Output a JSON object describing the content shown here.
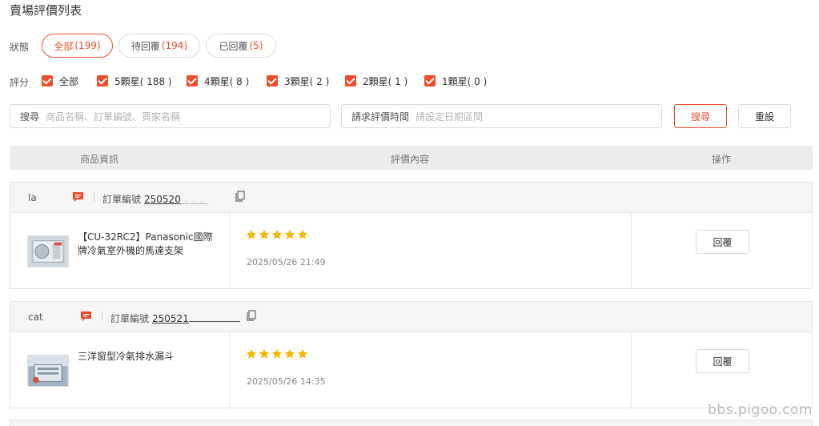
{
  "page_title": "賣場評價列表",
  "filters": {
    "status_label": "狀態",
    "status_pills": [
      {
        "label": "全部",
        "count": "(199)",
        "active": true
      },
      {
        "label": "待回覆",
        "count": "(194)",
        "active": false
      },
      {
        "label": "已回覆",
        "count": "(5)",
        "active": false
      }
    ],
    "rating_label": "評分",
    "rating_options": [
      {
        "label": "全部",
        "checked": true
      },
      {
        "label": "5顆星( 188 )",
        "checked": true
      },
      {
        "label": "4顆星( 8 )",
        "checked": true
      },
      {
        "label": "3顆星( 2 )",
        "checked": true
      },
      {
        "label": "2顆星( 1 )",
        "checked": true
      },
      {
        "label": "1顆星( 0 )",
        "checked": true
      }
    ],
    "search_label": "搜尋",
    "search_placeholder": "商品名稱、訂單編號、買家名稱",
    "date_label": "請求評價時間",
    "date_placeholder": "請設定日期區間",
    "search_button": "搜尋",
    "reset_button": "重設"
  },
  "table": {
    "headers": {
      "product": "商品資訊",
      "review": "評價內容",
      "action": "操作"
    }
  },
  "reviews": [
    {
      "buyer": "la",
      "order_label": "訂單編號",
      "order_no": "250520",
      "product_name": "【CU-32RC2】Panasonic國際牌冷氣室外機的馬達支架",
      "stars": 5,
      "time": "2025/05/26 21:49",
      "reply_button": "回覆"
    },
    {
      "buyer": "cat",
      "order_label": "訂單編號",
      "order_no": "250521",
      "product_name": "三洋窗型冷氣排水漏斗",
      "stars": 5,
      "time": "2025/05/26 14:35",
      "reply_button": "回覆"
    }
  ],
  "colors": {
    "accent": "#ee4d2d",
    "star": "#f6b600"
  },
  "watermark": "bbs.pigoo.com"
}
